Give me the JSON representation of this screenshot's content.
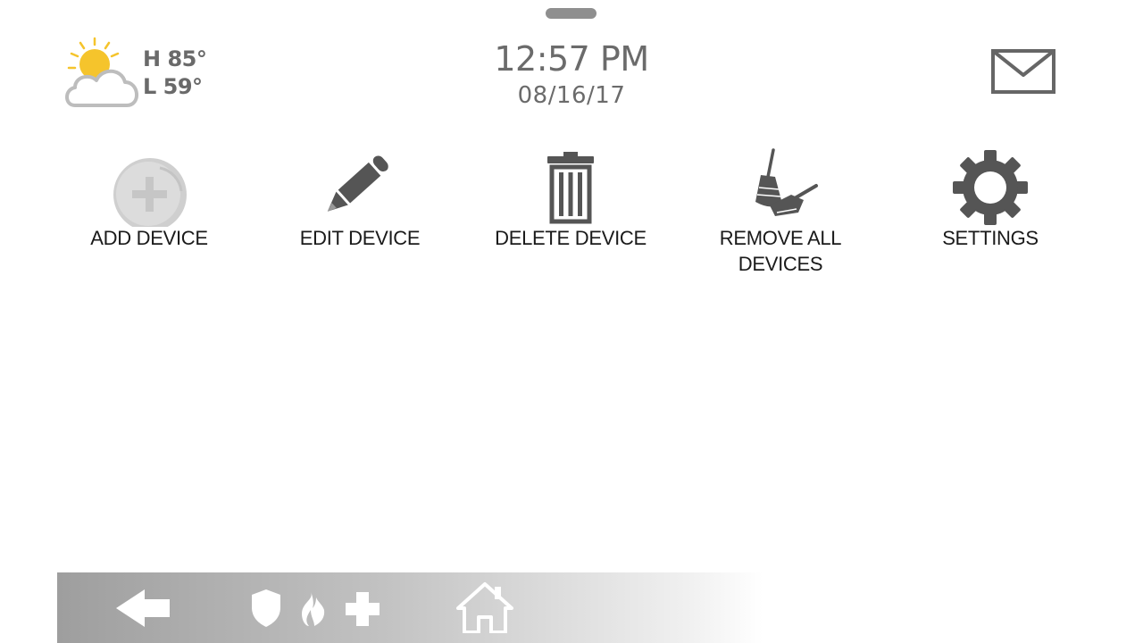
{
  "weather": {
    "high": "H 85°",
    "low": "L 59°"
  },
  "clock": {
    "time": "12:57 PM",
    "date": "08/16/17"
  },
  "actions": [
    {
      "label": "ADD DEVICE",
      "icon": "add-circle-icon"
    },
    {
      "label": "EDIT DEVICE",
      "icon": "pencil-icon"
    },
    {
      "label": "DELETE DEVICE",
      "icon": "trash-icon"
    },
    {
      "label": "REMOVE ALL DEVICES",
      "icon": "broom-dustpan-icon"
    },
    {
      "label": "SETTINGS",
      "icon": "gear-icon"
    }
  ],
  "nav": {
    "icons": [
      "back-arrow-icon",
      "shield-icon",
      "flame-icon",
      "medical-cross-icon",
      "home-icon"
    ]
  },
  "colors": {
    "icon_dark": "#555555",
    "text_gray": "#6b6b6b",
    "sun_yellow": "#f5c42c"
  }
}
